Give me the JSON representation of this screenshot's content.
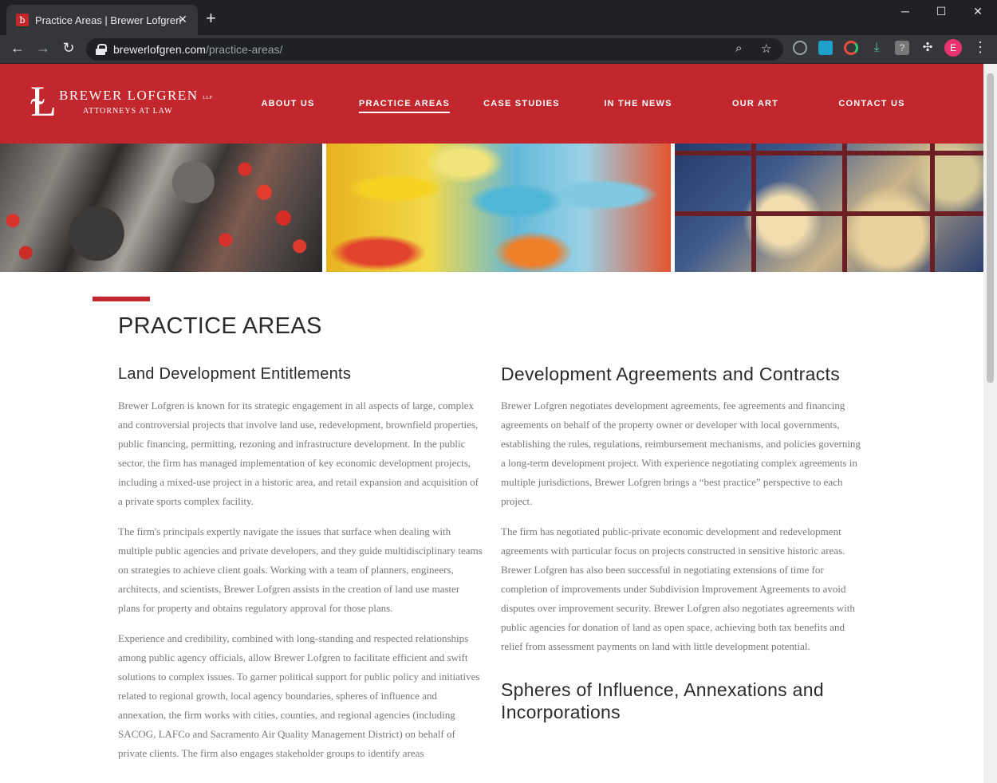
{
  "browser": {
    "tab_title": "Practice Areas | Brewer Lofgren",
    "url_host": "brewerlofgren.com",
    "url_path": "/practice-areas/",
    "profile_initial": "E"
  },
  "site": {
    "logo": {
      "name": "BREWER LOFGREN",
      "llp": "LLP",
      "tagline": "ATTORNEYS AT LAW"
    },
    "nav": [
      {
        "label": "ABOUT US",
        "active": false
      },
      {
        "label": "PRACTICE AREAS",
        "active": true
      },
      {
        "label": "CASE STUDIES",
        "active": false
      },
      {
        "label": "IN THE NEWS",
        "active": false
      },
      {
        "label": "OUR ART",
        "active": false
      },
      {
        "label": "CONTACT US",
        "active": false
      }
    ],
    "brand_color": "#c1272d"
  },
  "page": {
    "title": "PRACTICE AREAS",
    "left": {
      "heading": "Land Development Entitlements",
      "paragraphs": [
        "Brewer Lofgren is known for its strategic engagement in all aspects of large, complex and controversial projects that involve land use, redevelopment, brownfield properties, public financing, permitting, rezoning and infrastructure development. In the public sector, the firm has managed implementation of key economic development projects, including a mixed-use project in a historic area, and retail expansion and acquisition of a private sports complex facility.",
        "The firm's principals expertly navigate the issues that surface when dealing with multiple public agencies and private developers, and they guide multidisciplinary teams on strategies to achieve client goals. Working with a team of planners, engineers, architects, and scientists, Brewer Lofgren assists in the creation of land use master plans for property and obtains regulatory approval for those plans.",
        "Experience and credibility, combined with long-standing and respected relationships among public agency officials, allow Brewer Lofgren to facilitate efficient and swift solutions to complex issues. To garner political support for public policy and initiatives related to regional growth, local agency boundaries, spheres of influence and annexation, the firm works with cities, counties, and regional agencies (including SACOG, LAFCo and Sacramento Air Quality Management District) on behalf of private clients. The firm also engages stakeholder groups to identify areas"
      ]
    },
    "right": {
      "heading": "Development Agreements and Contracts",
      "paragraphs": [
        "Brewer Lofgren negotiates development agreements, fee agreements and financing agreements on behalf of the property owner or developer with local governments, establishing the rules, regulations, reimbursement mechanisms, and policies governing a long-term development project. With experience negotiating complex agreements in multiple jurisdictions, Brewer Lofgren brings a “best practice” perspective to each project.",
        "The firm has negotiated public-private economic development and redevelopment agreements with particular focus on projects constructed in sensitive historic areas. Brewer Lofgren has also been successful in negotiating extensions of time for completion of improvements under Subdivision Improvement Agreements to avoid disputes over improvement security.  Brewer Lofgren also negotiates agreements with public agencies for donation of land as open space, achieving both tax benefits and relief from assessment payments on land with little development potential."
      ],
      "heading2": "Spheres of Influence, Annexations and Incorporations"
    }
  }
}
